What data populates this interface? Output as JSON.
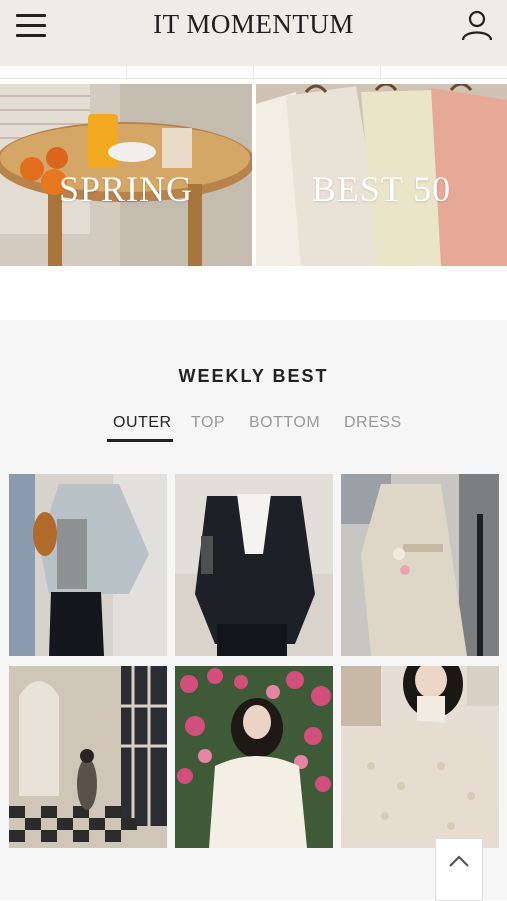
{
  "header": {
    "brand": "IT MOMENTUM",
    "menu_icon": "hamburger-menu-icon",
    "user_icon": "user-account-icon"
  },
  "banners": [
    {
      "label": "SPRING"
    },
    {
      "label": "BEST 50"
    }
  ],
  "weekly_best": {
    "title": "WEEKLY BEST",
    "tabs": [
      {
        "label": "OUTER",
        "active": true
      },
      {
        "label": "TOP",
        "active": false
      },
      {
        "label": "BOTTOM",
        "active": false
      },
      {
        "label": "DRESS",
        "active": false
      }
    ]
  },
  "scroll_top_icon": "chevron-up-icon",
  "colors": {
    "header_bg": "#efebe7",
    "section_bg": "#f6f6f6",
    "text_dark": "#222222",
    "text_muted": "#999999"
  }
}
